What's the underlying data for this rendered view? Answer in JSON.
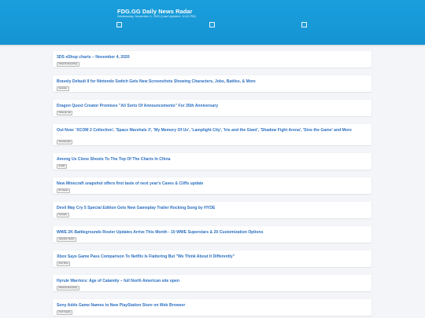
{
  "header": {
    "title": "FDG.GG Daily News Radar",
    "subtitle": "Wednesday, November 4, 2020 (Last Updated: 11:00 PM)",
    "checkbox_icon": "checkbox-icon"
  },
  "articles": [
    {
      "headline": "3DS eShop charts – November 4, 2020",
      "source": "Nintendo Everything"
    },
    {
      "headline": "Bravely Default II for Nintendo Switch Gets New Screenshots Showing Characters, Jobs, Battles, & More",
      "source": "Gematsu"
    },
    {
      "headline": "Dragon Quest Creator Promises \"All Sorts Of Announcements\" For 35th Anniversary",
      "source": "Nintendo Life"
    },
    {
      "headline": "Out Now: 'XCOM 2 Collection', 'Space Marshals 3', 'My Memory Of Us', 'Lamplight City', 'Iris and the Giant', 'Shadow Fight Arena', 'Sine the Game' and More",
      "source": "TouchArcade"
    },
    {
      "headline": "Among Us Clone Shoots To The Top Of The Charts In China",
      "source": "Kotaku"
    },
    {
      "headline": "New Minecraft snapshot offers first taste of next year's Caves & Cliffs update",
      "source": "PC Gamer"
    },
    {
      "headline": "Devil May Cry 5 Special Edition Gets New Gameplay Trailer Rocking Song by HYDE",
      "source": "Gematsu"
    },
    {
      "headline": "WWE 2K Battlegrounds Roster Updates Arrive This Month - 10 WWE Superstars & 20 Customization Options",
      "source": "Operation Sports"
    },
    {
      "headline": "Xbox Says Game Pass Comparison To Netflix Is Flattering But \"We Think About It Differently\"",
      "source": "Pure Xbox"
    },
    {
      "headline": "Hyrule Warriors: Age of Calamity – full North American site open",
      "source": "Nintendo Everything"
    },
    {
      "headline": "Sony Adds Game Names to New PlayStation Store on Web Browser",
      "source": "Push Square"
    }
  ]
}
